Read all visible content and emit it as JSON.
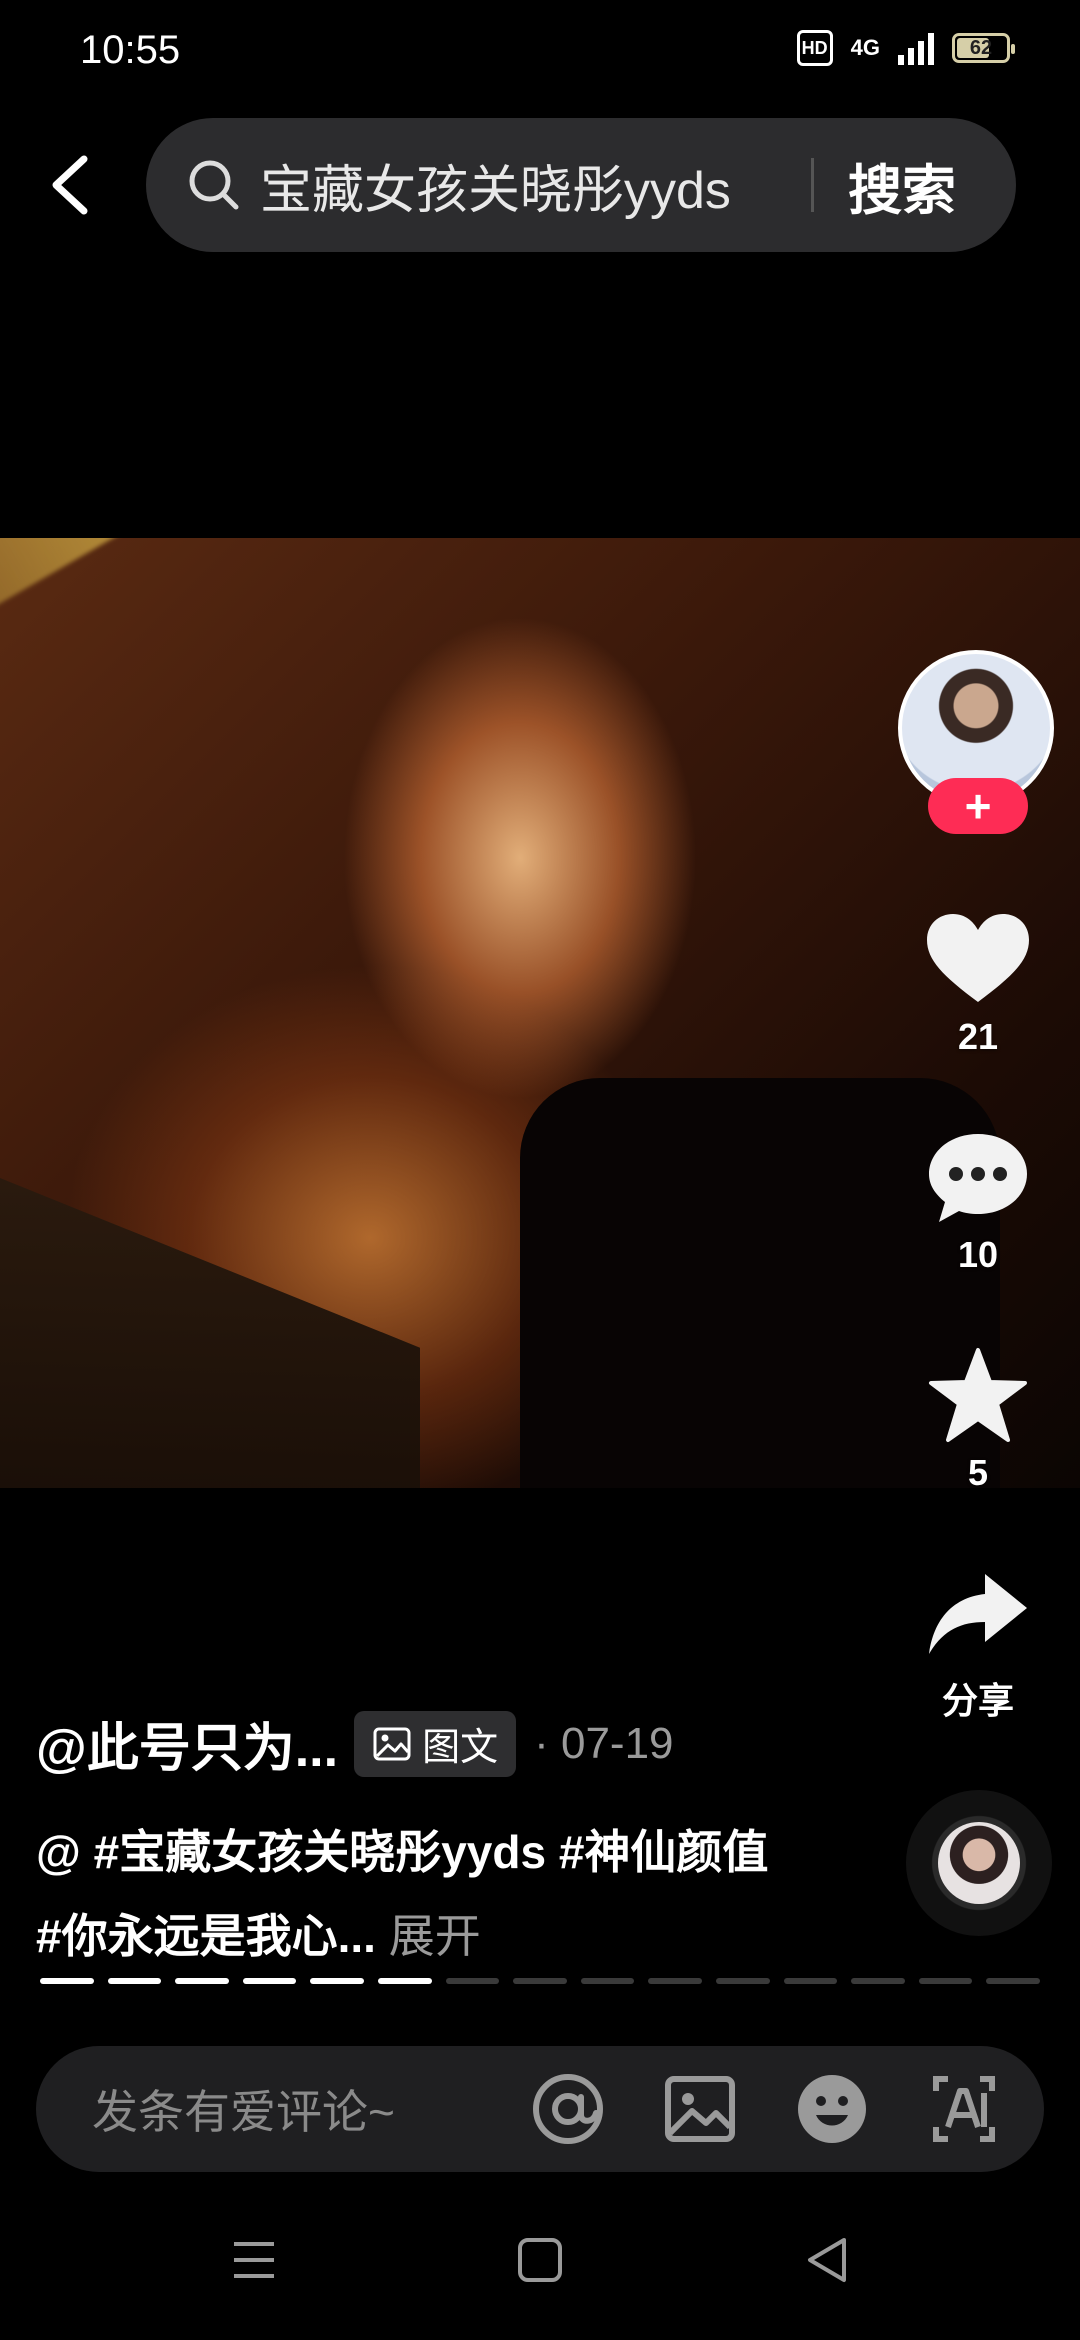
{
  "status": {
    "time": "10:55",
    "hd_badge": "HD",
    "network": "4G",
    "battery": "62",
    "battery_level": 0.62
  },
  "search": {
    "query": "宝藏女孩关晓彤yyds",
    "button": "搜索"
  },
  "actions": {
    "like_count": "21",
    "comment_count": "10",
    "favorite_count": "5",
    "share_label": "分享",
    "follow_symbol": "+"
  },
  "post": {
    "author": "@此号只为...",
    "type_label": "图文",
    "date_separator": "·",
    "date": "07-19",
    "caption": "@ #宝藏女孩关晓彤yyds #神仙颜值 #你永远是我心...",
    "expand": "展开"
  },
  "progress": {
    "total": 15,
    "current": 6
  },
  "comment_bar": {
    "placeholder": "发条有爱评论~"
  },
  "colors": {
    "accent": "#fe2c55",
    "background": "#000000"
  },
  "icons": [
    "back-icon",
    "search-icon",
    "heart-icon",
    "comment-icon",
    "star-icon",
    "share-icon",
    "image-icon",
    "at-icon",
    "emoji-icon",
    "ai-icon",
    "menu-icon",
    "home-icon",
    "back-triangle-icon"
  ]
}
